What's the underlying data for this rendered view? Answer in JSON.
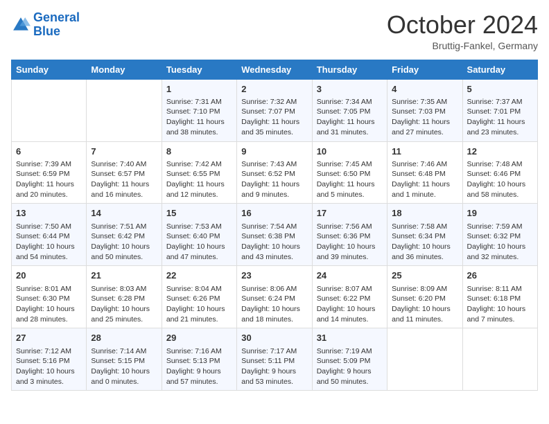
{
  "header": {
    "logo_line1": "General",
    "logo_line2": "Blue",
    "month_title": "October 2024",
    "location": "Bruttig-Fankel, Germany"
  },
  "days_of_week": [
    "Sunday",
    "Monday",
    "Tuesday",
    "Wednesday",
    "Thursday",
    "Friday",
    "Saturday"
  ],
  "weeks": [
    [
      {
        "day": "",
        "info": ""
      },
      {
        "day": "",
        "info": ""
      },
      {
        "day": "1",
        "info": "Sunrise: 7:31 AM\nSunset: 7:10 PM\nDaylight: 11 hours and 38 minutes."
      },
      {
        "day": "2",
        "info": "Sunrise: 7:32 AM\nSunset: 7:07 PM\nDaylight: 11 hours and 35 minutes."
      },
      {
        "day": "3",
        "info": "Sunrise: 7:34 AM\nSunset: 7:05 PM\nDaylight: 11 hours and 31 minutes."
      },
      {
        "day": "4",
        "info": "Sunrise: 7:35 AM\nSunset: 7:03 PM\nDaylight: 11 hours and 27 minutes."
      },
      {
        "day": "5",
        "info": "Sunrise: 7:37 AM\nSunset: 7:01 PM\nDaylight: 11 hours and 23 minutes."
      }
    ],
    [
      {
        "day": "6",
        "info": "Sunrise: 7:39 AM\nSunset: 6:59 PM\nDaylight: 11 hours and 20 minutes."
      },
      {
        "day": "7",
        "info": "Sunrise: 7:40 AM\nSunset: 6:57 PM\nDaylight: 11 hours and 16 minutes."
      },
      {
        "day": "8",
        "info": "Sunrise: 7:42 AM\nSunset: 6:55 PM\nDaylight: 11 hours and 12 minutes."
      },
      {
        "day": "9",
        "info": "Sunrise: 7:43 AM\nSunset: 6:52 PM\nDaylight: 11 hours and 9 minutes."
      },
      {
        "day": "10",
        "info": "Sunrise: 7:45 AM\nSunset: 6:50 PM\nDaylight: 11 hours and 5 minutes."
      },
      {
        "day": "11",
        "info": "Sunrise: 7:46 AM\nSunset: 6:48 PM\nDaylight: 11 hours and 1 minute."
      },
      {
        "day": "12",
        "info": "Sunrise: 7:48 AM\nSunset: 6:46 PM\nDaylight: 10 hours and 58 minutes."
      }
    ],
    [
      {
        "day": "13",
        "info": "Sunrise: 7:50 AM\nSunset: 6:44 PM\nDaylight: 10 hours and 54 minutes."
      },
      {
        "day": "14",
        "info": "Sunrise: 7:51 AM\nSunset: 6:42 PM\nDaylight: 10 hours and 50 minutes."
      },
      {
        "day": "15",
        "info": "Sunrise: 7:53 AM\nSunset: 6:40 PM\nDaylight: 10 hours and 47 minutes."
      },
      {
        "day": "16",
        "info": "Sunrise: 7:54 AM\nSunset: 6:38 PM\nDaylight: 10 hours and 43 minutes."
      },
      {
        "day": "17",
        "info": "Sunrise: 7:56 AM\nSunset: 6:36 PM\nDaylight: 10 hours and 39 minutes."
      },
      {
        "day": "18",
        "info": "Sunrise: 7:58 AM\nSunset: 6:34 PM\nDaylight: 10 hours and 36 minutes."
      },
      {
        "day": "19",
        "info": "Sunrise: 7:59 AM\nSunset: 6:32 PM\nDaylight: 10 hours and 32 minutes."
      }
    ],
    [
      {
        "day": "20",
        "info": "Sunrise: 8:01 AM\nSunset: 6:30 PM\nDaylight: 10 hours and 28 minutes."
      },
      {
        "day": "21",
        "info": "Sunrise: 8:03 AM\nSunset: 6:28 PM\nDaylight: 10 hours and 25 minutes."
      },
      {
        "day": "22",
        "info": "Sunrise: 8:04 AM\nSunset: 6:26 PM\nDaylight: 10 hours and 21 minutes."
      },
      {
        "day": "23",
        "info": "Sunrise: 8:06 AM\nSunset: 6:24 PM\nDaylight: 10 hours and 18 minutes."
      },
      {
        "day": "24",
        "info": "Sunrise: 8:07 AM\nSunset: 6:22 PM\nDaylight: 10 hours and 14 minutes."
      },
      {
        "day": "25",
        "info": "Sunrise: 8:09 AM\nSunset: 6:20 PM\nDaylight: 10 hours and 11 minutes."
      },
      {
        "day": "26",
        "info": "Sunrise: 8:11 AM\nSunset: 6:18 PM\nDaylight: 10 hours and 7 minutes."
      }
    ],
    [
      {
        "day": "27",
        "info": "Sunrise: 7:12 AM\nSunset: 5:16 PM\nDaylight: 10 hours and 3 minutes."
      },
      {
        "day": "28",
        "info": "Sunrise: 7:14 AM\nSunset: 5:15 PM\nDaylight: 10 hours and 0 minutes."
      },
      {
        "day": "29",
        "info": "Sunrise: 7:16 AM\nSunset: 5:13 PM\nDaylight: 9 hours and 57 minutes."
      },
      {
        "day": "30",
        "info": "Sunrise: 7:17 AM\nSunset: 5:11 PM\nDaylight: 9 hours and 53 minutes."
      },
      {
        "day": "31",
        "info": "Sunrise: 7:19 AM\nSunset: 5:09 PM\nDaylight: 9 hours and 50 minutes."
      },
      {
        "day": "",
        "info": ""
      },
      {
        "day": "",
        "info": ""
      }
    ]
  ]
}
